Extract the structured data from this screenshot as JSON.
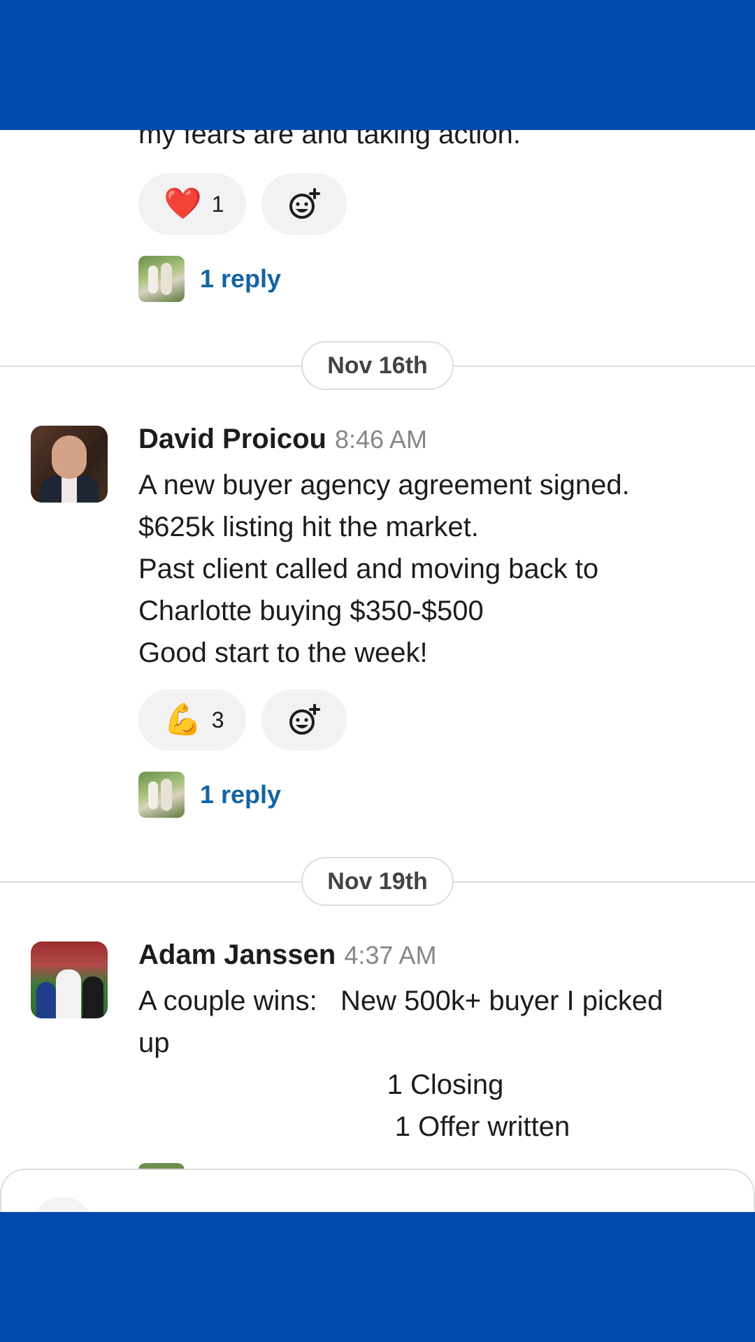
{
  "colors": {
    "brand_bar": "#004aad",
    "link": "#1264a3",
    "timestamp": "#868686"
  },
  "messages": [
    {
      "text_lines": [
        "my fears are and taking action."
      ],
      "reaction": {
        "emoji": "❤️",
        "emoji_name": "red-heart-icon",
        "count": "1"
      },
      "add_reaction_icon": "add-reaction-icon",
      "replies": "1 reply"
    },
    {
      "date": "Nov 16th",
      "sender": "David Proicou",
      "time": "8:46 AM",
      "text_lines": [
        "A new buyer agency agreement signed.",
        "$625k listing hit the market.",
        "Past client called and moving back to",
        "Charlotte buying $350-$500",
        "Good start to the week!"
      ],
      "reaction": {
        "emoji": "💪",
        "emoji_name": "flexed-biceps-icon",
        "count": "3"
      },
      "add_reaction_icon": "add-reaction-icon",
      "replies": "1 reply"
    },
    {
      "date": "Nov 19th",
      "sender": "Adam Janssen",
      "time": "4:37 AM",
      "text_lines": [
        "A couple wins:   New 500k+ buyer I picked",
        "up",
        "                                1 Closing",
        "                                 1 Offer written"
      ]
    }
  ]
}
